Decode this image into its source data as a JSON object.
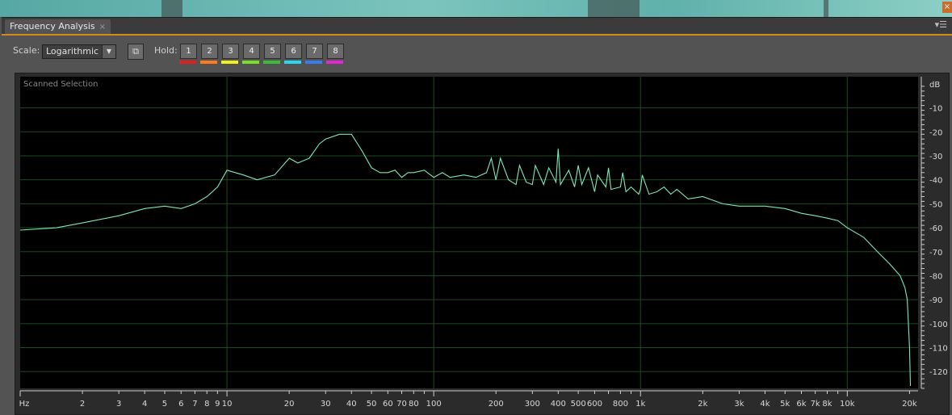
{
  "panel": {
    "tab_label": "Frequency Analysis",
    "tab_close_icon": "close-icon",
    "panel_menu_icon": "panel-menu-icon",
    "accent_color": "#d48a1c"
  },
  "toolbar": {
    "scale_label": "Scale:",
    "scale_value": "Logarithmic",
    "copy_icon": "copy-to-clipboard-icon",
    "hold_label": "Hold:",
    "holds": [
      {
        "label": "1",
        "color": "#e02020"
      },
      {
        "label": "2",
        "color": "#ff7a1a"
      },
      {
        "label": "3",
        "color": "#f0f020"
      },
      {
        "label": "4",
        "color": "#7cde2a"
      },
      {
        "label": "5",
        "color": "#3dba3d"
      },
      {
        "label": "6",
        "color": "#28d7f0"
      },
      {
        "label": "7",
        "color": "#3a7cf0"
      },
      {
        "label": "8",
        "color": "#e028d0"
      }
    ]
  },
  "plot": {
    "title": "Scanned Selection",
    "background": "#000000",
    "grid_color": "#1f4a1f",
    "trace_color": "#7fe8b8"
  },
  "chart_data": {
    "type": "line",
    "title": "Scanned Selection",
    "xlabel": "Hz",
    "ylabel": "dB",
    "x_scale": "log",
    "xlim": [
      1,
      22000
    ],
    "ylim": [
      -127,
      3
    ],
    "grid": true,
    "x_ticks": [
      {
        "v": 1,
        "label": "Hz"
      },
      {
        "v": 2,
        "label": "2"
      },
      {
        "v": 3,
        "label": "3"
      },
      {
        "v": 4,
        "label": "4"
      },
      {
        "v": 5,
        "label": "5"
      },
      {
        "v": 6,
        "label": "6"
      },
      {
        "v": 7,
        "label": "7"
      },
      {
        "v": 8,
        "label": "8"
      },
      {
        "v": 9,
        "label": "9"
      },
      {
        "v": 10,
        "label": "10"
      },
      {
        "v": 20,
        "label": "20"
      },
      {
        "v": 30,
        "label": "30"
      },
      {
        "v": 40,
        "label": "40"
      },
      {
        "v": 50,
        "label": "50"
      },
      {
        "v": 60,
        "label": "60"
      },
      {
        "v": 70,
        "label": "70"
      },
      {
        "v": 80,
        "label": "80"
      },
      {
        "v": 100,
        "label": "100"
      },
      {
        "v": 200,
        "label": "200"
      },
      {
        "v": 300,
        "label": "300"
      },
      {
        "v": 400,
        "label": "400"
      },
      {
        "v": 500,
        "label": "500"
      },
      {
        "v": 600,
        "label": "600"
      },
      {
        "v": 800,
        "label": "800"
      },
      {
        "v": 1000,
        "label": "1k"
      },
      {
        "v": 2000,
        "label": "2k"
      },
      {
        "v": 3000,
        "label": "3k"
      },
      {
        "v": 4000,
        "label": "4k"
      },
      {
        "v": 5000,
        "label": "5k"
      },
      {
        "v": 6000,
        "label": "6k"
      },
      {
        "v": 7000,
        "label": "7k"
      },
      {
        "v": 8000,
        "label": "8k"
      },
      {
        "v": 10000,
        "label": "10k"
      },
      {
        "v": 20000,
        "label": "20k"
      }
    ],
    "major_x": [
      10,
      100,
      1000,
      10000
    ],
    "y_ticks": [
      {
        "v": 0,
        "label": "dB"
      },
      {
        "v": -10,
        "label": "-10"
      },
      {
        "v": -20,
        "label": "-20"
      },
      {
        "v": -30,
        "label": "-30"
      },
      {
        "v": -40,
        "label": "-40"
      },
      {
        "v": -50,
        "label": "-50"
      },
      {
        "v": -60,
        "label": "-60"
      },
      {
        "v": -70,
        "label": "-70"
      },
      {
        "v": -80,
        "label": "-80"
      },
      {
        "v": -90,
        "label": "-90"
      },
      {
        "v": -100,
        "label": "-100"
      },
      {
        "v": -110,
        "label": "-110"
      },
      {
        "v": -120,
        "label": "-120"
      }
    ],
    "series": [
      {
        "x": [
          1,
          1.5,
          2,
          3,
          4,
          5,
          6,
          7,
          8,
          9,
          10,
          12,
          14,
          17,
          20,
          22,
          25,
          28,
          30,
          35,
          40,
          45,
          50,
          55,
          60,
          65,
          70,
          75,
          80,
          90,
          100,
          110,
          120,
          140,
          160,
          180,
          190,
          200,
          210,
          230,
          250,
          260,
          280,
          300,
          310,
          340,
          360,
          390,
          400,
          410,
          450,
          480,
          500,
          520,
          560,
          600,
          620,
          680,
          700,
          720,
          800,
          820,
          850,
          900,
          980,
          1000,
          1020,
          1100,
          1200,
          1300,
          1400,
          1500,
          1700,
          2000,
          2500,
          3000,
          4000,
          5000,
          6000,
          7000,
          8000,
          9000,
          10000,
          12000,
          14000,
          16000,
          18000,
          19000,
          19500,
          20000,
          20200
        ],
        "y": [
          -61,
          -60,
          -58,
          -55,
          -52,
          -51,
          -52,
          -50,
          -47,
          -43,
          -36,
          -38,
          -40,
          -38,
          -31,
          -33,
          -31,
          -25,
          -23,
          -21,
          -21,
          -28,
          -35,
          -37,
          -37,
          -36,
          -39,
          -37,
          -37,
          -36,
          -39,
          -37,
          -39,
          -38,
          -39,
          -37,
          -31,
          -40,
          -31,
          -40,
          -42,
          -34,
          -41,
          -42,
          -34,
          -42,
          -35,
          -41,
          -27,
          -42,
          -36,
          -43,
          -34,
          -42,
          -35,
          -45,
          -38,
          -43,
          -35,
          -44,
          -43,
          -37,
          -45,
          -43,
          -46,
          -44,
          -38,
          -46,
          -45,
          -43,
          -46,
          -44,
          -48,
          -47,
          -50,
          -51,
          -51,
          -52,
          -54,
          -55,
          -56,
          -57,
          -60,
          -64,
          -70,
          -75,
          -80,
          -85,
          -90,
          -110,
          -126
        ]
      }
    ]
  }
}
